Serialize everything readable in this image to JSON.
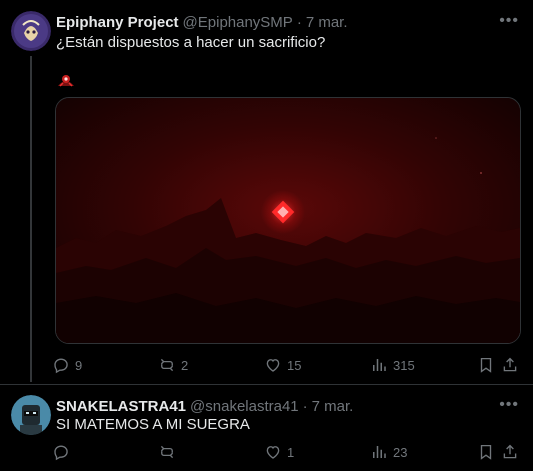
{
  "tweets": [
    {
      "name": "Epiphany Project",
      "handle": "@EpiphanySMP",
      "dot": "·",
      "time": "7 mar.",
      "text": "¿Están dispuestos a hacer un sacrificio?",
      "stats": {
        "replies": "9",
        "reposts": "2",
        "likes": "15",
        "views": "315"
      }
    },
    {
      "name": "SNAKELASTRA41",
      "handle": "@snakelastra41",
      "dot": "·",
      "time": "7 mar.",
      "text": "SI MATEMOS A MI SUEGRA",
      "stats": {
        "replies": "",
        "reposts": "",
        "likes": "1",
        "views": "23"
      }
    }
  ],
  "colors": {
    "background": "#000000",
    "muted": "#71767b",
    "text": "#e7e9ea",
    "border": "#2f3336"
  }
}
